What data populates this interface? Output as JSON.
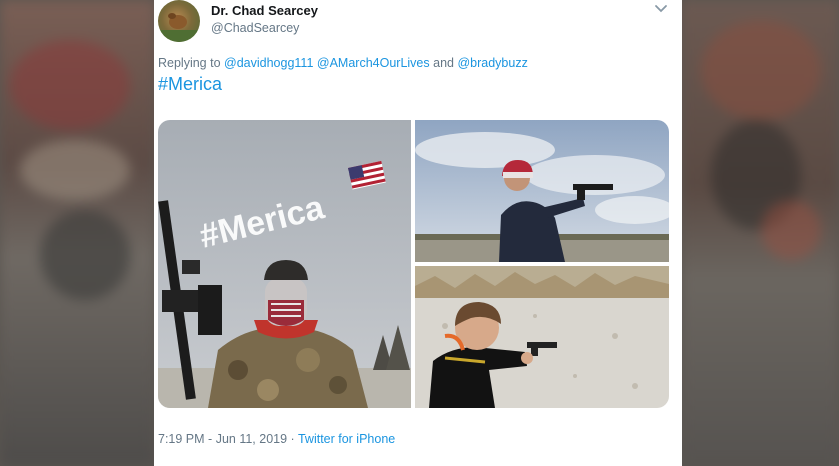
{
  "tweet": {
    "display_name": "Dr. Chad Searcey",
    "handle": "@ChadSearcey",
    "replying_prefix": "Replying to",
    "replying_to": [
      "@davidhogg111",
      "@AMarch4OurLives"
    ],
    "replying_and": "and",
    "replying_last": "@bradybuzz",
    "text": "#Merica",
    "photo_overlay_text": "#Merica",
    "time": "7:19 PM",
    "date_separator": "-",
    "date": "Jun 11, 2019",
    "source_separator": "·",
    "source": "Twitter for iPhone"
  },
  "icons": {
    "menu": "chevron-down-icon",
    "flag": "us-flag-icon"
  },
  "colors": {
    "link": "#1b95e0",
    "secondary_text": "#657786",
    "primary_text": "#14171a"
  }
}
